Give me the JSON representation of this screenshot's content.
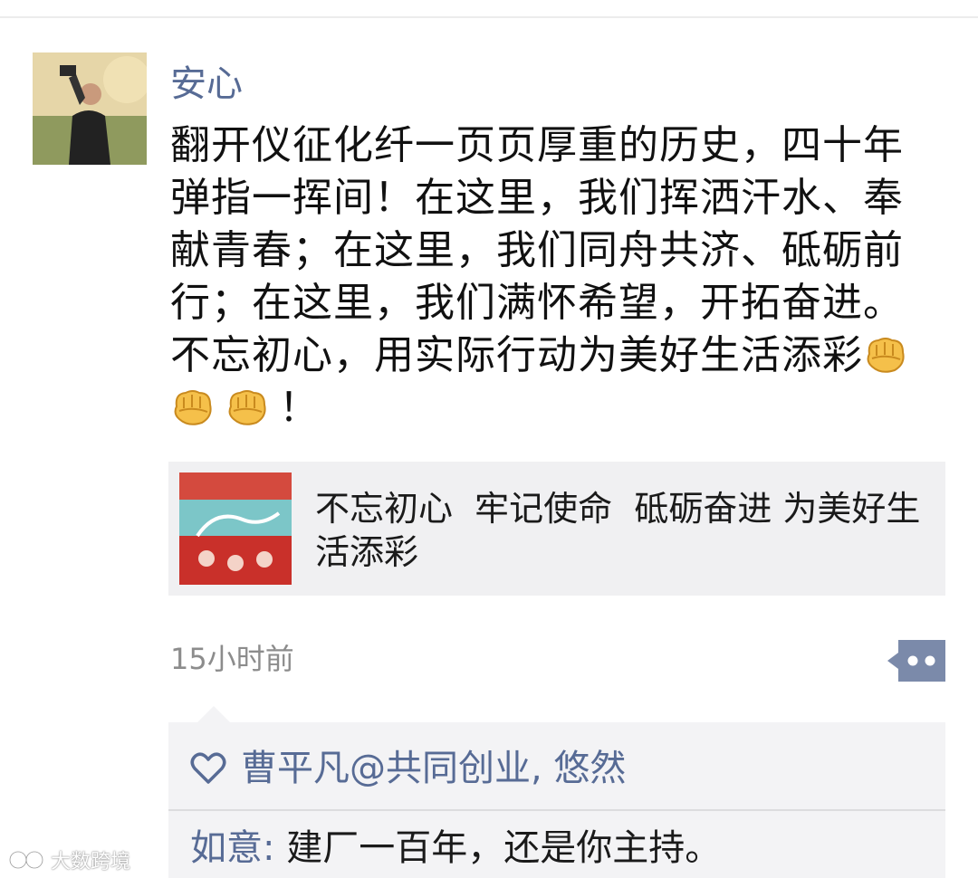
{
  "post": {
    "author": "安心",
    "text_before_emoji": "翻开仪征化纤一页页厚重的历史，四十年弹指一挥间！在这里，我们挥洒汗水、奉献青春；在这里，我们同舟共济、砥砺前行；在这里，我们满怀希望，开拓奋进。不忘初心，用实际行动为美好生活添彩",
    "emoji": [
      "fist-emoji",
      "fist-emoji",
      "fist-emoji"
    ],
    "text_after_emoji": "！",
    "shared_link": {
      "title": "不忘初心  牢记使命  砥砺奋进 为美好生活添彩"
    },
    "timestamp": "15小时前"
  },
  "interactions": {
    "likes": "曹平凡@共同创业, 悠然",
    "comments": [
      {
        "author": "如意",
        "separator": ": ",
        "text": "建厂一百年，还是你主持。"
      }
    ]
  },
  "watermark": {
    "text": "大数跨境"
  },
  "colors": {
    "name_blue": "#576b95",
    "card_bg": "#f0f0f2",
    "comment_bg": "#f3f3f5",
    "timestamp_gray": "#8c8c8c"
  }
}
